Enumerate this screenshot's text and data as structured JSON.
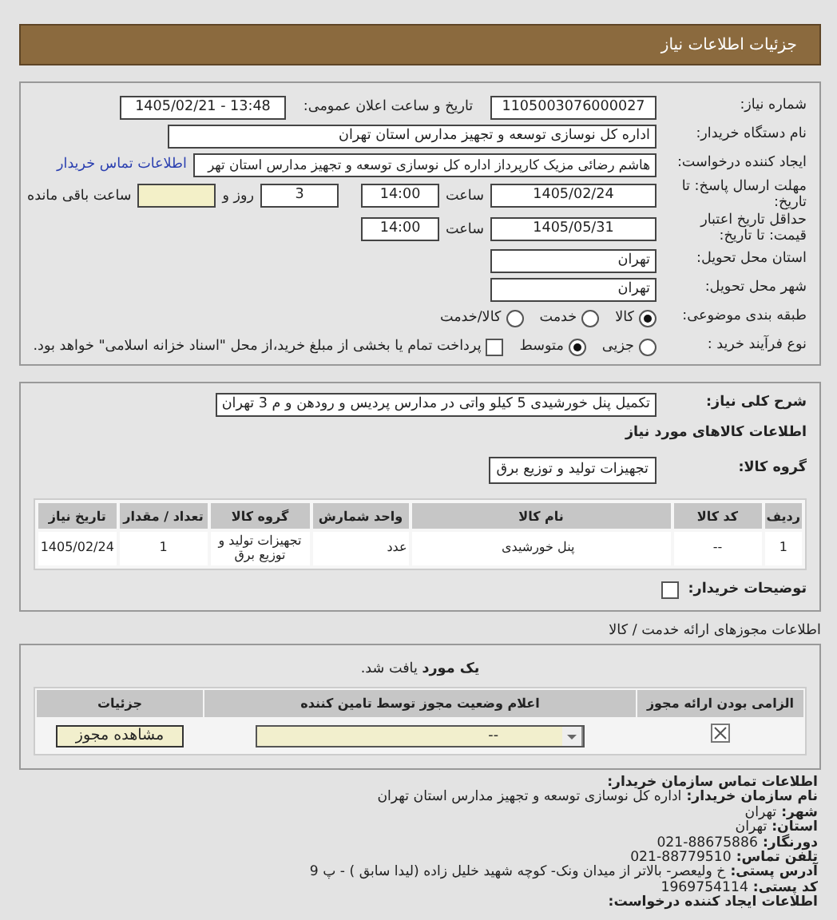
{
  "header": {
    "title": "جزئیات اطلاعات نیاز"
  },
  "need_number": {
    "label": "شماره نیاز:",
    "value": "1105003076000027"
  },
  "announce": {
    "label": "تاریخ و ساعت اعلان عمومی:",
    "value": "1405/02/21 - 13:48"
  },
  "buyer": {
    "label": "نام دستگاه خریدار:",
    "value": "اداره کل نوسازی  توسعه و تجهیز مدارس استان تهران"
  },
  "creator": {
    "label": "ایجاد کننده درخواست:",
    "value": "هاشم رضائی مزیک کارپرداز اداره کل نوسازی  توسعه و تجهیز مدارس استان تهر",
    "link": "اطلاعات تماس خریدار"
  },
  "deadline": {
    "label": "مهلت ارسال پاسخ: تا تاریخ:",
    "date": "1405/02/24",
    "time_label": "ساعت",
    "time": "14:00",
    "days": "3",
    "days_label": "روز و",
    "remaining_label": "ساعت باقی مانده"
  },
  "validity": {
    "label": "حداقل تاریخ اعتبار قیمت: تا تاریخ:",
    "date": "1405/05/31",
    "time_label": "ساعت",
    "time": "14:00"
  },
  "province": {
    "label": "استان محل تحویل:",
    "value": "تهران"
  },
  "city": {
    "label": "شهر محل تحویل:",
    "value": "تهران"
  },
  "category": {
    "label": "طبقه بندی موضوعی:",
    "options": [
      {
        "label": "کالا",
        "selected": true
      },
      {
        "label": "خدمت",
        "selected": false
      },
      {
        "label": "کالا/خدمت",
        "selected": false
      }
    ]
  },
  "process": {
    "label": "نوع فرآیند خرید :",
    "options": [
      {
        "label": "جزیی",
        "selected": false
      },
      {
        "label": "متوسط",
        "selected": true
      }
    ],
    "treasury": {
      "checked": false,
      "text": "پرداخت تمام یا بخشی از مبلغ خرید،از محل \"اسناد خزانه اسلامی\" خواهد بود."
    }
  },
  "description": {
    "label": "شرح کلی نیاز:",
    "value": "تکمیل پنل خورشیدی 5 کیلو واتی در مدارس پردیس و رودهن و م 3 تهران"
  },
  "goods_title": "اطلاعات کالاهای مورد نیاز",
  "goods_group": {
    "label": "گروه کالا:",
    "value": "تجهیزات تولید و توزیع برق"
  },
  "goods_table": {
    "columns": [
      "ردیف",
      "کد کالا",
      "نام کالا",
      "واحد شمارش",
      "گروه کالا",
      "تعداد / مقدار",
      "تاریخ نیاز"
    ],
    "rows": [
      [
        "1",
        "--",
        "پنل خورشیدی",
        "عدد",
        "تجهیزات تولید و توزیع برق",
        "1",
        "1405/02/24"
      ]
    ]
  },
  "buyer_notes": {
    "label": "توضیحات خریدار:",
    "checked": false
  },
  "licenses_title": "اطلاعات مجوزهای ارائه خدمت / کالا",
  "licenses": {
    "found": "**یک مورد** یافت شد.",
    "columns": [
      "الزامی بودن ارائه مجوز",
      "اعلام وضعیت مجوز توسط تامین کننده",
      "جزئیات"
    ],
    "rows": [
      {
        "required": true,
        "status": "--",
        "action": "مشاهده مجوز"
      }
    ]
  },
  "contact": {
    "title": "اطلاعات تماس سازمان خریدار:",
    "items": [
      {
        "label": "نام سازمان خریدار:",
        "value": "اداره کل نوسازی توسعه و تجهیز مدارس استان تهران"
      },
      {
        "label": "شهر:",
        "value": "تهران"
      },
      {
        "label": "استان:",
        "value": "تهران"
      },
      {
        "label": "دورنگار:",
        "value": "021-88675886"
      },
      {
        "label": "تلفن تماس:",
        "value": "021-88779510"
      },
      {
        "label": "آدرس پستی:",
        "value": "خ ولیعصر- بالاتر از میدان ونک- کوچه شهید خلیل زاده (لیدا سابق ) - پ 9"
      },
      {
        "label": "کد پستی:",
        "value": "1969754114"
      }
    ],
    "creator_title": "اطلاعات ایجاد کننده درخواست:"
  }
}
